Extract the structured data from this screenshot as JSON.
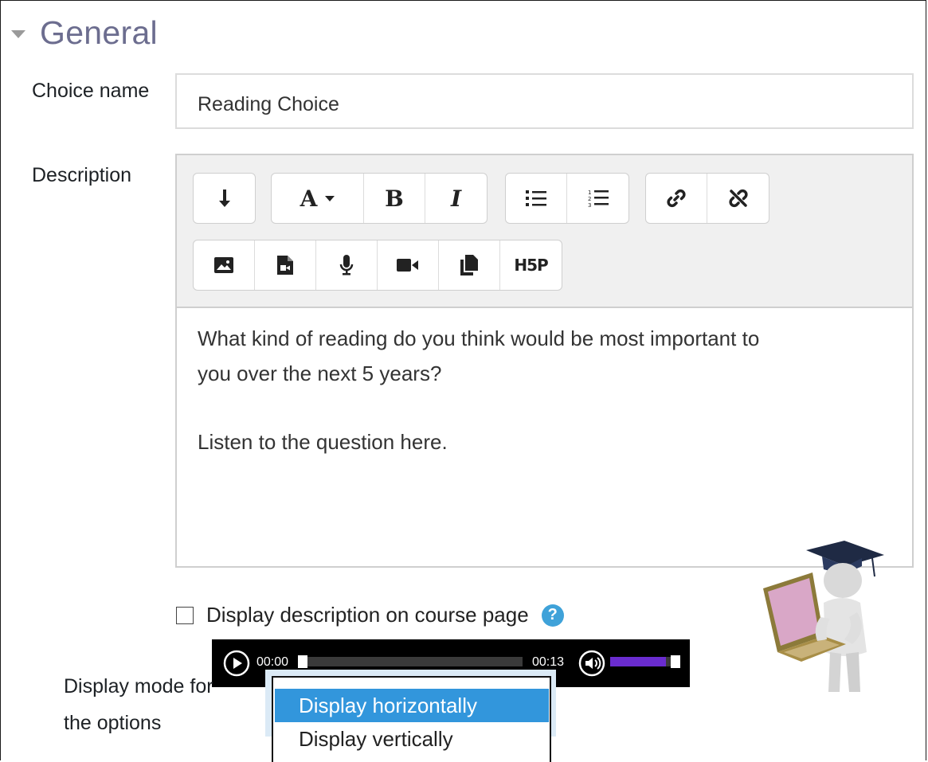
{
  "section": {
    "title": "General"
  },
  "choice_name": {
    "label": "Choice name",
    "value": "Reading Choice"
  },
  "description": {
    "label": "Description",
    "toolbar_row1": [
      {
        "icon": "expand-toolbar-icon"
      },
      {
        "icon": "font-style-icon",
        "label": "A"
      },
      {
        "icon": "bold-icon",
        "label": "B"
      },
      {
        "icon": "italic-icon",
        "label": "I"
      },
      {
        "icon": "unordered-list-icon"
      },
      {
        "icon": "ordered-list-icon"
      },
      {
        "icon": "link-icon"
      },
      {
        "icon": "unlink-icon"
      }
    ],
    "toolbar_row2": [
      {
        "icon": "image-icon"
      },
      {
        "icon": "media-icon"
      },
      {
        "icon": "microphone-icon"
      },
      {
        "icon": "video-camera-icon"
      },
      {
        "icon": "manage-files-icon"
      },
      {
        "icon": "h5p-icon",
        "label": "H5P"
      }
    ],
    "paragraph1_line1": "What kind of reading do you think would be most important to",
    "paragraph1_line2": "you over the next 5 years?",
    "paragraph2": "Listen to the question here.",
    "audio": {
      "current_time": "00:00",
      "duration": "00:13",
      "progress": 0.0,
      "volume": 0.85
    }
  },
  "display_description": {
    "label": "Display description on course page",
    "checked": false
  },
  "display_mode": {
    "label_line1": "Display mode for",
    "label_line2": "the options",
    "options": [
      "Display horizontally",
      "Display vertically"
    ],
    "highlighted": "Display horizontally"
  },
  "colors": {
    "accent": "#3296dc",
    "section_title": "#6c6d8f",
    "help": "#3fa2d9",
    "volume_bar": "#6a2ccf"
  }
}
